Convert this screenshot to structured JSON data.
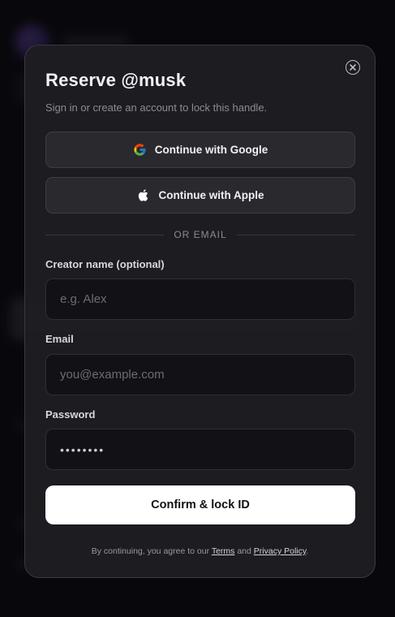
{
  "modal": {
    "title": "Reserve @musk",
    "subtitle": "Sign in or create an account to lock this handle.",
    "google_label": "Continue with Google",
    "apple_label": "Continue with Apple",
    "divider_text": "OR EMAIL",
    "creator_label": "Creator name (optional)",
    "creator_placeholder": "e.g. Alex",
    "email_label": "Email",
    "email_placeholder": "you@example.com",
    "password_label": "Password",
    "password_value": "••••••••",
    "confirm_label": "Confirm & lock ID",
    "legal_prefix": "By continuing, you agree to our",
    "terms_link": "Terms",
    "legal_and": "and",
    "privacy_link": "Privacy Policy",
    "legal_suffix": "."
  },
  "icons": {
    "close": "close-icon",
    "google": "google-icon",
    "apple": "apple-icon"
  },
  "colors": {
    "modal_bg": "#1e1d21",
    "input_bg": "#121115",
    "primary_button": "#ffffff"
  }
}
